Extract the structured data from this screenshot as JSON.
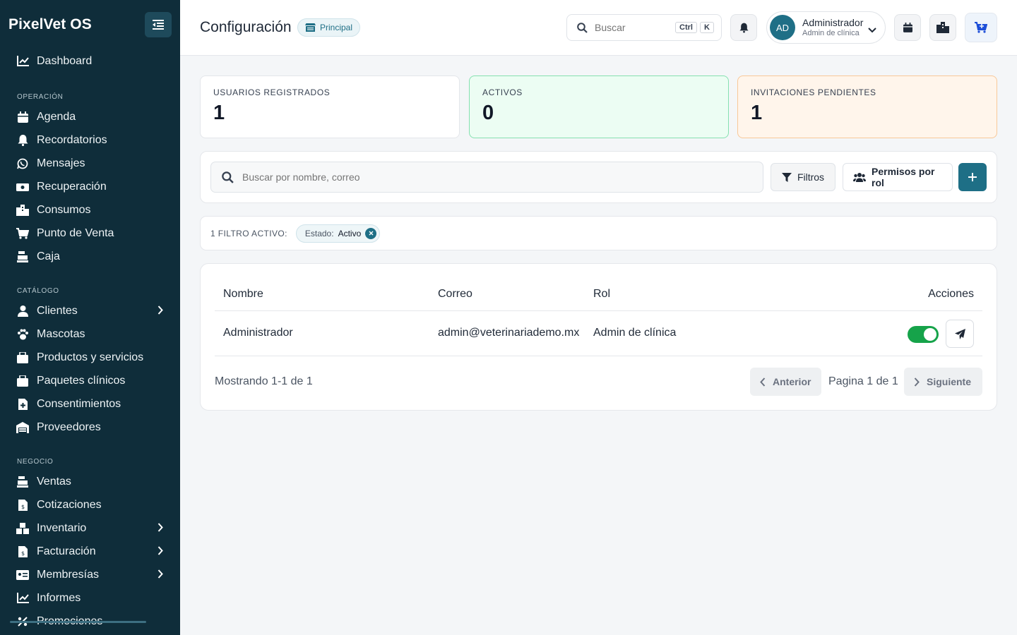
{
  "app": {
    "brand": "PixelVet OS"
  },
  "sidebar": {
    "top": [
      {
        "label": "Dashboard",
        "icon": "chart-line-icon"
      }
    ],
    "sections": [
      {
        "title": "OPERACIÓN",
        "items": [
          {
            "label": "Agenda",
            "icon": "calendar-icon"
          },
          {
            "label": "Recordatorios",
            "icon": "bell-icon"
          },
          {
            "label": "Mensajes",
            "icon": "whatsapp-icon"
          },
          {
            "label": "Recuperación",
            "icon": "money-icon"
          },
          {
            "label": "Consumos",
            "icon": "building-icon"
          },
          {
            "label": "Punto de Venta",
            "icon": "cart-icon"
          },
          {
            "label": "Caja",
            "icon": "cash-register-icon"
          }
        ]
      },
      {
        "title": "CATÁLOGO",
        "items": [
          {
            "label": "Clientes",
            "icon": "user-icon",
            "chevron": true
          },
          {
            "label": "Mascotas",
            "icon": "paw-icon"
          },
          {
            "label": "Productos y servicios",
            "icon": "box-icon"
          },
          {
            "label": "Paquetes clínicos",
            "icon": "box-icon"
          },
          {
            "label": "Consentimientos",
            "icon": "file-medical-icon"
          },
          {
            "label": "Proveedores",
            "icon": "warehouse-icon"
          }
        ]
      },
      {
        "title": "NEGOCIO",
        "items": [
          {
            "label": "Ventas",
            "icon": "cash-register-icon"
          },
          {
            "label": "Cotizaciones",
            "icon": "invoice-icon"
          },
          {
            "label": "Inventario",
            "icon": "boxes-icon",
            "chevron": true
          },
          {
            "label": "Facturación",
            "icon": "invoice-icon",
            "chevron": true
          },
          {
            "label": "Membresías",
            "icon": "id-card-icon",
            "chevron": true
          },
          {
            "label": "Informes",
            "icon": "chart-line-icon"
          },
          {
            "label": "Promociones",
            "icon": "percent-icon"
          }
        ]
      }
    ]
  },
  "header": {
    "title": "Configuración",
    "branch": "Principal",
    "search_placeholder": "Buscar",
    "shortcut": [
      "Ctrl",
      "K"
    ],
    "user": {
      "initials": "AD",
      "name": "Administrador",
      "role": "Admin de clínica"
    }
  },
  "stats": [
    {
      "label": "USUARIOS REGISTRADOS",
      "value": "1"
    },
    {
      "label": "ACTIVOS",
      "value": "0"
    },
    {
      "label": "INVITACIONES PENDIENTES",
      "value": "1"
    }
  ],
  "toolbar": {
    "search_placeholder": "Buscar por nombre, correo",
    "filters_label": "Filtros",
    "permissions_label": "Permisos por rol"
  },
  "filters": {
    "count_label": "1 FILTRO ACTIVO:",
    "chip_key": "Estado:",
    "chip_value": "Activo"
  },
  "table": {
    "columns": [
      "Nombre",
      "Correo",
      "Rol",
      "Acciones"
    ],
    "rows": [
      {
        "name": "Administrador",
        "email": "admin@veterinariademo.mx",
        "role": "Admin de clínica",
        "active": true
      }
    ]
  },
  "pagination": {
    "showing": "Mostrando 1-1 de 1",
    "prev": "Anterior",
    "page_info": "Pagina 1 de 1",
    "next": "Siguiente"
  }
}
